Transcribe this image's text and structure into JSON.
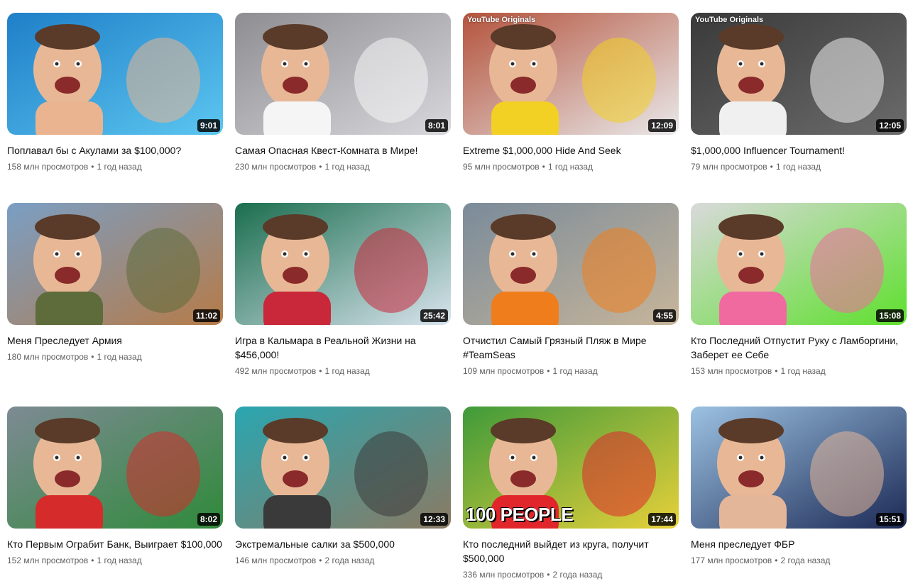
{
  "videos": [
    {
      "title": "Поплавал бы с Акулами за $100,000?",
      "views": "158 млн просмотров",
      "age": "1 год назад",
      "duration": "9:01",
      "badge": "",
      "overlay": "",
      "palette": [
        "#1f7fc8",
        "#5cc6f0",
        "#e9b48f"
      ]
    },
    {
      "title": "Самая Опасная Квест-Комната в Мире!",
      "views": "230 млн просмотров",
      "age": "1 год назад",
      "duration": "8:01",
      "badge": "",
      "overlay": "",
      "palette": [
        "#8e8e92",
        "#d8d8dc",
        "#f5f5f5"
      ]
    },
    {
      "title": "Extreme $1,000,000 Hide And Seek",
      "views": "95 млн просмотров",
      "age": "1 год назад",
      "duration": "12:09",
      "badge": "YouTube Originals",
      "overlay": "",
      "palette": [
        "#b4533c",
        "#e9e9ea",
        "#f2d024"
      ]
    },
    {
      "title": "$1,000,000 Influencer Tournament!",
      "views": "79 млн просмотров",
      "age": "1 год назад",
      "duration": "12:05",
      "badge": "YouTube Originals",
      "overlay": "",
      "palette": [
        "#3a3a3a",
        "#6b6b6b",
        "#f0f0f0"
      ]
    },
    {
      "title": "Меня Преследует Армия",
      "views": "180 млн просмотров",
      "age": "1 год назад",
      "duration": "11:02",
      "badge": "",
      "overlay": "",
      "palette": [
        "#7a9ec4",
        "#b67b48",
        "#5e6b3a"
      ]
    },
    {
      "title": "Игра в Кальмара в Реальной Жизни на $456,000!",
      "views": "492 млн просмотров",
      "age": "1 год назад",
      "duration": "25:42",
      "badge": "",
      "overlay": "",
      "palette": [
        "#1b6e4f",
        "#d9e4ee",
        "#c9283a"
      ]
    },
    {
      "title": "Отчистил Самый Грязный Пляж в Мире #TeamSeas",
      "views": "109 млн просмотров",
      "age": "1 год назад",
      "duration": "4:55",
      "badge": "",
      "overlay": "",
      "palette": [
        "#7a8b9a",
        "#c7b59a",
        "#f07d1c"
      ]
    },
    {
      "title": "Кто Последний Отпустит Руку с Ламборгини, Заберет ее Себе",
      "views": "153 млн просмотров",
      "age": "1 год назад",
      "duration": "15:08",
      "badge": "",
      "overlay": "",
      "palette": [
        "#d9d9db",
        "#5ee02d",
        "#f06aa0"
      ]
    },
    {
      "title": "Кто Первым Ограбит Банк, Выиграет $100,000",
      "views": "152 млн просмотров",
      "age": "1 год назад",
      "duration": "8:02",
      "badge": "",
      "overlay": "",
      "palette": [
        "#7e8a94",
        "#2f8a3a",
        "#d62b2b"
      ]
    },
    {
      "title": "Экстремальные салки за $500,000",
      "views": "146 млн просмотров",
      "age": "2 года назад",
      "duration": "12:33",
      "badge": "",
      "overlay": "",
      "palette": [
        "#2aa6b0",
        "#8b7a63",
        "#3a3a3a"
      ]
    },
    {
      "title": "Кто последний выйдет из круга, получит $500,000",
      "views": "336 млн просмотров",
      "age": "2 года назад",
      "duration": "17:44",
      "badge": "",
      "overlay": "100 PEOPLE",
      "palette": [
        "#3f9a3a",
        "#e7d03a",
        "#e0262b"
      ]
    },
    {
      "title": "Меня преследует ФБР",
      "views": "177 млн просмотров",
      "age": "2 года назад",
      "duration": "15:51",
      "badge": "",
      "overlay": "",
      "palette": [
        "#9cc2e3",
        "#1c2a55",
        "#e4b699"
      ]
    }
  ]
}
